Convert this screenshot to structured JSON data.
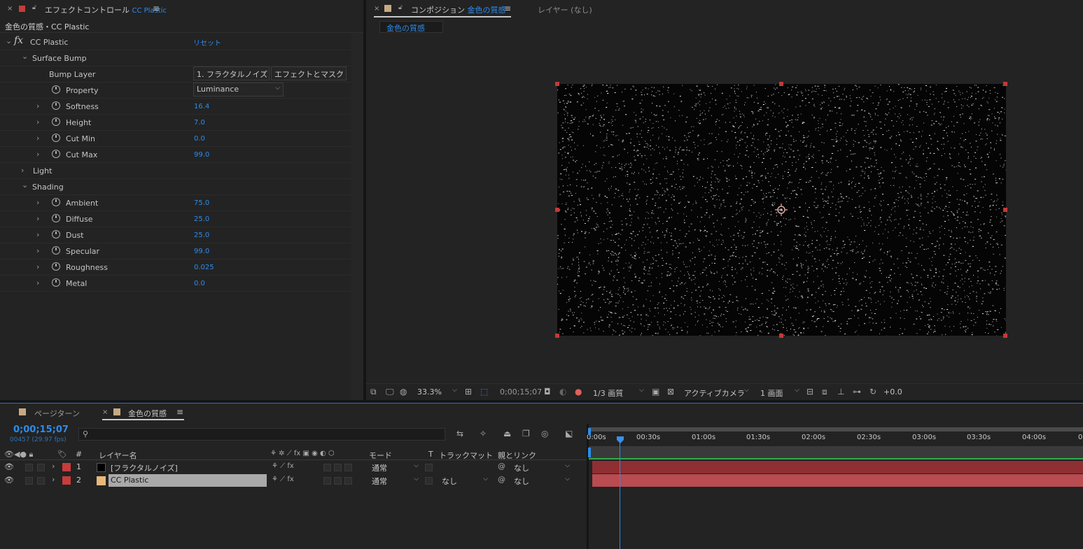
{
  "effect_controls": {
    "tab_title": "エフェクトコントロール",
    "tab_effect": "CC Plastic",
    "breadcrumb": "金色の質感・CC Plastic",
    "effect_name": "CC Plastic",
    "reset_label": "リセット",
    "surface_bump_label": "Surface Bump",
    "bump_layer_label": "Bump Layer",
    "bump_layer_value": "1. フラクタルノイズ",
    "bump_layer_source": "エフェクトとマスク",
    "property_label": "Property",
    "property_value": "Luminance",
    "params1": [
      {
        "label": "Softness",
        "value": "16.4"
      },
      {
        "label": "Height",
        "value": "7.0"
      },
      {
        "label": "Cut Min",
        "value": "0.0"
      },
      {
        "label": "Cut Max",
        "value": "99.0"
      }
    ],
    "light_label": "Light",
    "shading_label": "Shading",
    "params2": [
      {
        "label": "Ambient",
        "value": "75.0"
      },
      {
        "label": "Diffuse",
        "value": "25.0"
      },
      {
        "label": "Dust",
        "value": "25.0"
      },
      {
        "label": "Specular",
        "value": "99.0"
      },
      {
        "label": "Roughness",
        "value": "0.025"
      },
      {
        "label": "Metal",
        "value": "0.0"
      }
    ]
  },
  "composition": {
    "tab_title": "コンポジション",
    "tab_comp": "金色の質感",
    "layer_tab": "レイヤー (なし)",
    "comp_chip": "金色の質感",
    "zoom": "33.3%",
    "timecode": "0;00;15;07",
    "resolution": "1/3 画質",
    "camera": "アクティブカメラ",
    "views": "1 画面",
    "exposure": "+0.0"
  },
  "timeline": {
    "tab_inactive": "ページターン",
    "tab_active": "金色の質感",
    "timecode": "0;00;15;07",
    "frames": "00457 (29.97 fps)",
    "col_num": "#",
    "col_name": "レイヤー名",
    "col_mode": "モード",
    "col_t": "T",
    "col_matte": "トラックマット",
    "col_parent": "親とリンク",
    "layers": [
      {
        "num": "1",
        "name": "[フラクタルノイズ]",
        "mode": "通常",
        "matte": "",
        "parent": "なし",
        "swatch": "#000000"
      },
      {
        "num": "2",
        "name": "CC Plastic",
        "mode": "通常",
        "matte": "なし",
        "parent": "なし",
        "swatch": "#e8b87a"
      }
    ],
    "ruler": [
      "0:00s",
      "00:30s",
      "01:00s",
      "01:30s",
      "02:00s",
      "02:30s",
      "03:00s",
      "03:30s",
      "04:00s",
      "0"
    ]
  },
  "colors": {
    "accent": "#2d8ceb",
    "label_red": "#c73c3c",
    "bar_red": "#8e2f33"
  }
}
